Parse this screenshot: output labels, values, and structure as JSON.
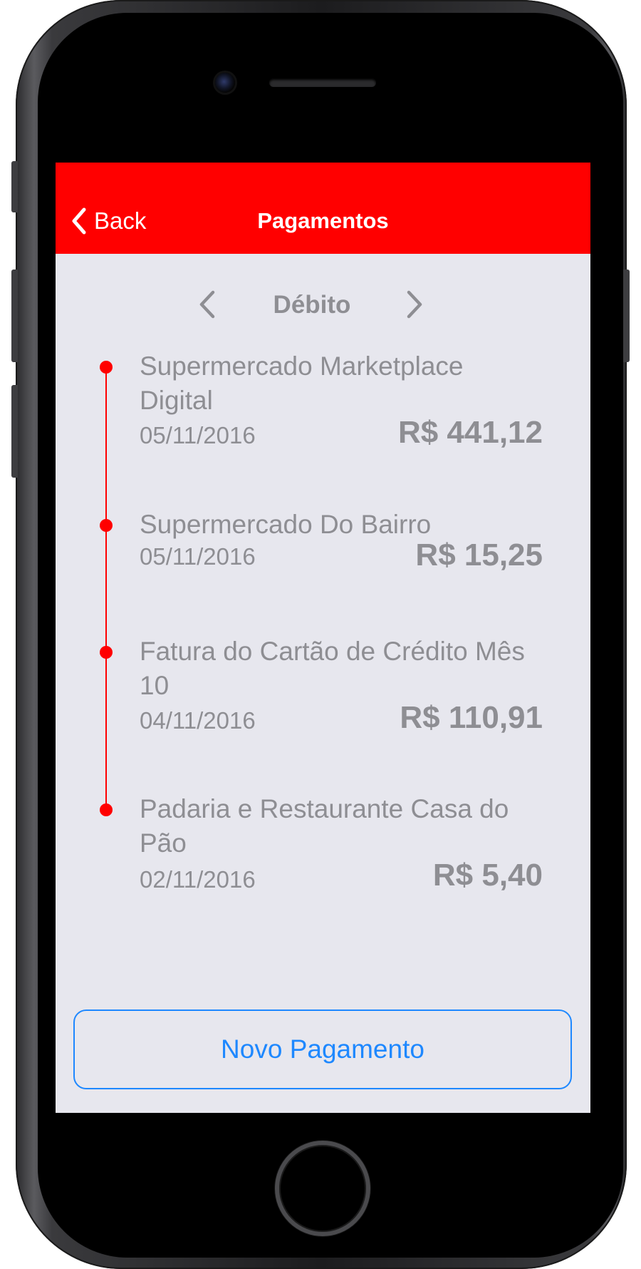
{
  "nav": {
    "back_label": "Back",
    "title": "Pagamentos",
    "back_icon": "chevron-left-icon"
  },
  "segment": {
    "label": "Débito",
    "prev_icon": "chevron-left-icon",
    "next_icon": "chevron-right-icon"
  },
  "payments": [
    {
      "name": "Supermercado Marketplace Digital",
      "date": "05/11/2016",
      "amount": "R$ 441,12"
    },
    {
      "name": "Supermercado Do Bairro",
      "date": "05/11/2016",
      "amount": "R$ 15,25"
    },
    {
      "name": "Fatura do Cartão de Crédito Mês 10",
      "date": "04/11/2016",
      "amount": "R$ 110,91"
    },
    {
      "name": "Padaria e Restaurante Casa do Pão",
      "date": "02/11/2016",
      "amount": "R$ 5,40"
    }
  ],
  "actions": {
    "new_payment_label": "Novo Pagamento"
  },
  "colors": {
    "nav_background": "#ff0000",
    "timeline": "#ff0000",
    "screen_background": "#e7e7ee",
    "muted_text": "#8e8e93",
    "button_accent": "#1e88ff"
  }
}
